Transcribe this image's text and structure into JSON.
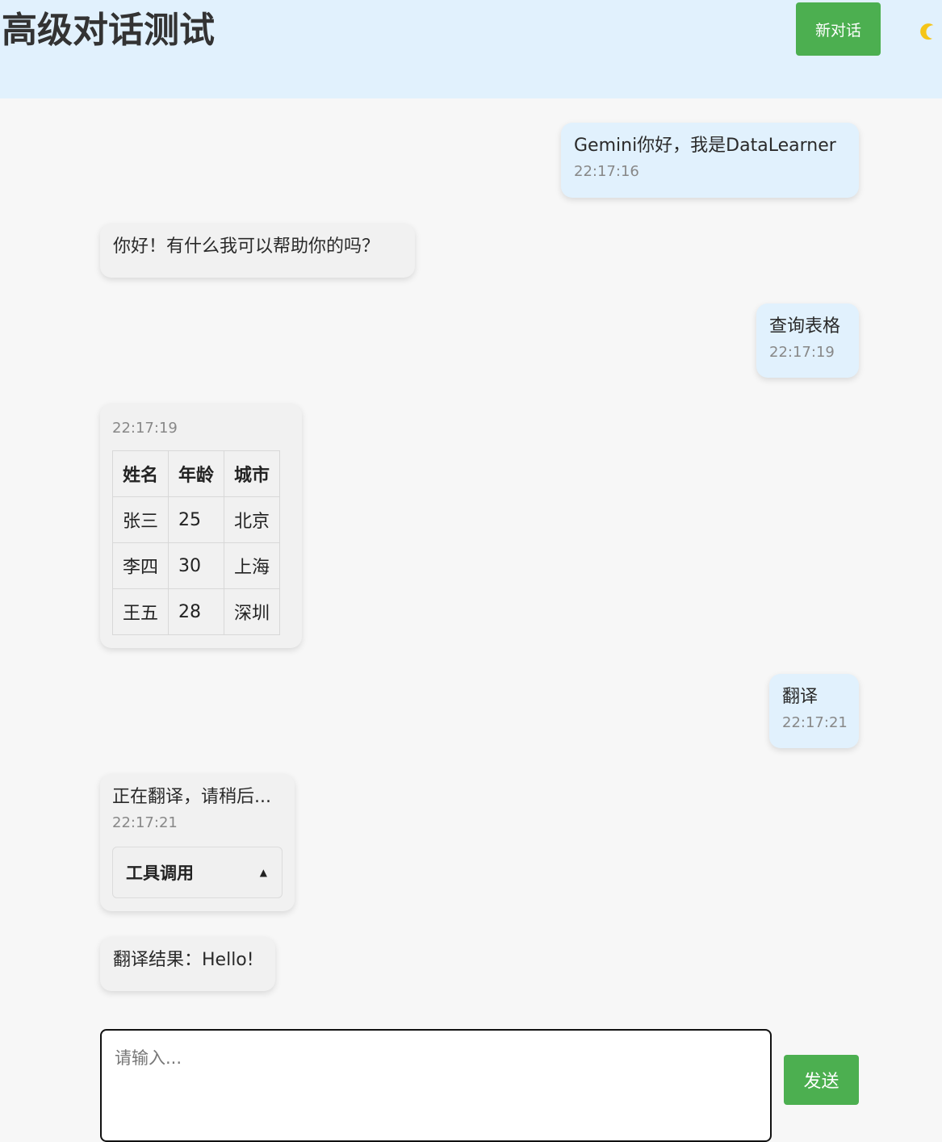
{
  "header": {
    "title": "高级对话测试",
    "new_chat_label": "新对话",
    "theme_icon": "moon-icon"
  },
  "messages": [
    {
      "role": "user",
      "text": "Gemini你好，我是DataLearner",
      "time": "22:17:16"
    },
    {
      "role": "bot",
      "text": "你好！有什么我可以帮助你的吗？"
    },
    {
      "role": "user",
      "text": "查询表格",
      "time": "22:17:19"
    },
    {
      "role": "bot",
      "time": "22:17:19",
      "table": {
        "headers": [
          "姓名",
          "年龄",
          "城市"
        ],
        "rows": [
          [
            "张三",
            "25",
            "北京"
          ],
          [
            "李四",
            "30",
            "上海"
          ],
          [
            "王五",
            "28",
            "深圳"
          ]
        ]
      }
    },
    {
      "role": "user",
      "text": "翻译",
      "time": "22:17:21"
    },
    {
      "role": "bot",
      "text": "正在翻译，请稍后...",
      "time": "22:17:21",
      "tool_label": "工具调用",
      "tool_arrow": "▲"
    },
    {
      "role": "bot",
      "text": "翻译结果：Hello!"
    }
  ],
  "composer": {
    "placeholder": "请输入...",
    "send_label": "发送"
  },
  "colors": {
    "accent": "#4caf50",
    "header_bg": "#e1f1fd",
    "user_bubble": "#e1f1fd",
    "bot_bubble": "#f1f1f1"
  }
}
